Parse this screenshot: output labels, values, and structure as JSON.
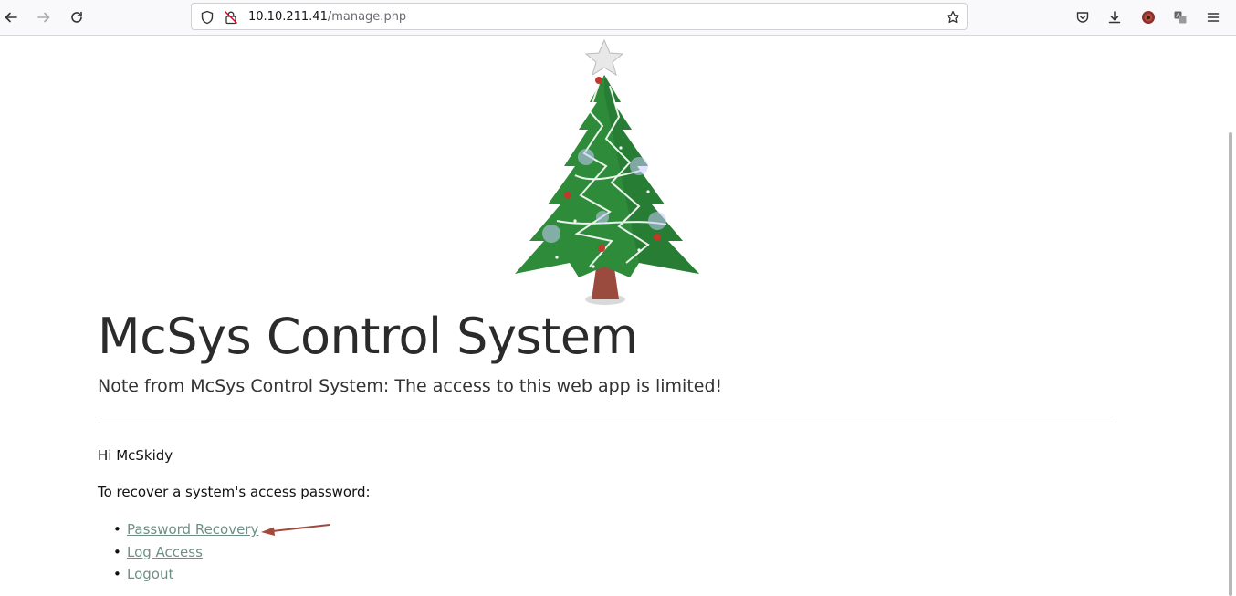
{
  "browser": {
    "url_host": "10.10.211.41",
    "url_path": "/manage.php",
    "icons": [
      "back-icon",
      "forward-icon",
      "reload-icon",
      "shield-icon",
      "insecure-lock-icon",
      "bookmark-star-icon",
      "pocket-icon",
      "download-icon",
      "profile-icon",
      "translate-icon",
      "menu-icon"
    ]
  },
  "page": {
    "title": "McSys Control System",
    "note": "Note from McSys Control System: The access to this web app is limited!",
    "greeting": "Hi McSkidy",
    "instruction": "To recover a system's access password:",
    "links": [
      {
        "label": "Password Recovery"
      },
      {
        "label": "Log Access"
      },
      {
        "label": "Logout"
      }
    ],
    "bullet": "•"
  },
  "colors": {
    "link": "#6f8f86",
    "arrow": "#a3493c",
    "tree_green": "#2e8b3a",
    "trunk": "#9b4a3e"
  }
}
